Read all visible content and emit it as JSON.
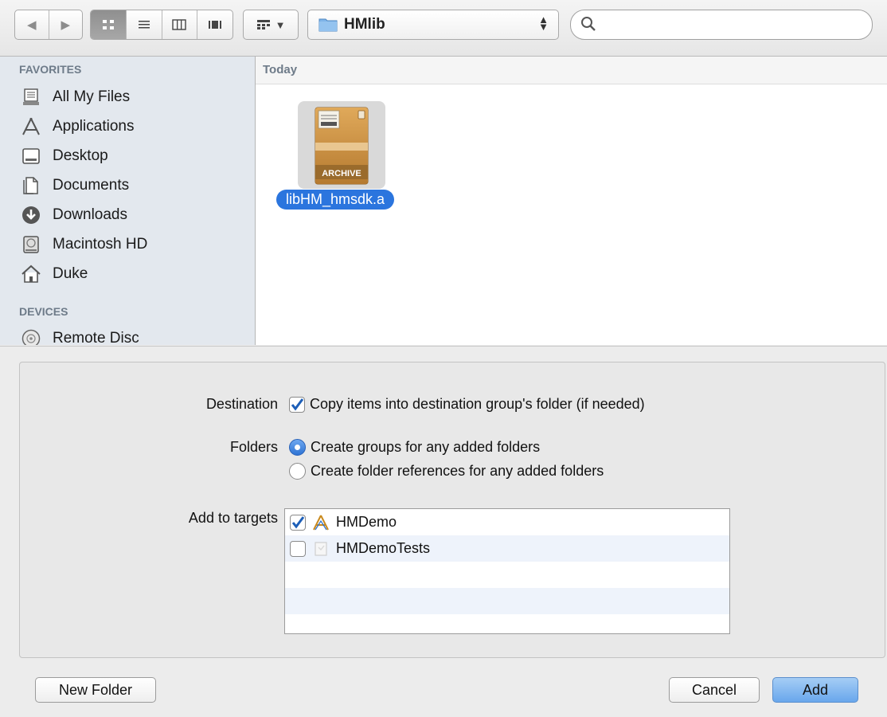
{
  "toolbar": {
    "nav": {
      "back_glyph": "◀",
      "forward_glyph": "▶"
    },
    "view_modes": [
      {
        "icon": "icon-view-icon",
        "glyph": "☷",
        "active": true
      },
      {
        "icon": "list-view-icon",
        "glyph": "≡",
        "active": false
      },
      {
        "icon": "column-view-icon",
        "glyph": "◫",
        "active": false
      },
      {
        "icon": "coverflow-view-icon",
        "glyph": "▥",
        "active": false
      }
    ],
    "arrange_glyph": "▼",
    "path": {
      "label": "HMlib"
    },
    "search": {
      "value": "",
      "placeholder": ""
    }
  },
  "sidebar": {
    "favorites_header": "FAVORITES",
    "devices_header": "DEVICES",
    "favorites": [
      {
        "label": "All My Files",
        "icon": "all-files-icon"
      },
      {
        "label": "Applications",
        "icon": "applications-icon"
      },
      {
        "label": "Desktop",
        "icon": "desktop-icon"
      },
      {
        "label": "Documents",
        "icon": "documents-icon"
      },
      {
        "label": "Downloads",
        "icon": "downloads-icon"
      },
      {
        "label": "Macintosh HD",
        "icon": "hard-drive-icon"
      },
      {
        "label": "Duke",
        "icon": "home-icon"
      }
    ],
    "devices": [
      {
        "label": "Remote Disc",
        "icon": "remote-disc-icon"
      }
    ]
  },
  "files": {
    "date_group": "Today",
    "items": [
      {
        "name": "libHM_hmsdk.a",
        "icon_caption": "ARCHIVE",
        "selected": true
      }
    ]
  },
  "options": {
    "destination_label": "Destination",
    "destination_option": "Copy items into destination group's folder (if needed)",
    "destination_checked": true,
    "folders_label": "Folders",
    "folders_options": [
      {
        "label": "Create groups for any added folders",
        "selected": true
      },
      {
        "label": "Create folder references for any added folders",
        "selected": false
      }
    ],
    "targets_label": "Add to targets",
    "targets": [
      {
        "name": "HMDemo",
        "checked": true
      },
      {
        "name": "HMDemoTests",
        "checked": false
      }
    ]
  },
  "buttons": {
    "new_folder": "New Folder",
    "cancel": "Cancel",
    "add": "Add"
  },
  "colors": {
    "selection": "#2b75de",
    "sidebar_bg": "#e3e8ee",
    "section_header": "#6e7b89",
    "primary_button": "#69a7ec"
  }
}
